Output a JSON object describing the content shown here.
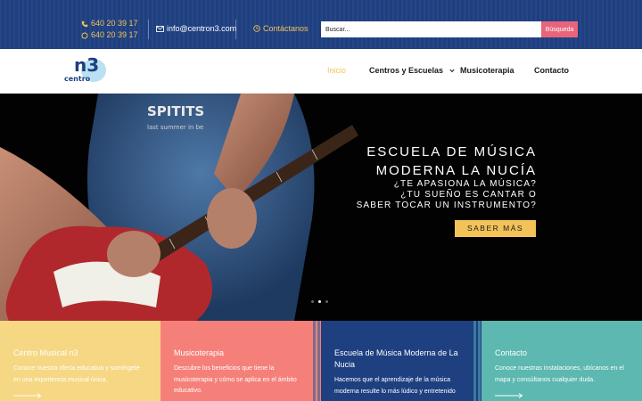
{
  "topbar": {
    "phone1": "640 20 39 17",
    "phone2": "640 20 39 17",
    "email": "info@centron3.com",
    "contact_label": "Contáctanos",
    "search_placeholder": "Buscar...",
    "search_button": "Búsqueda"
  },
  "logo": {
    "text_small": "centro",
    "text_big": "n3"
  },
  "nav": {
    "inicio": "Inicio",
    "centros": "Centros y Escuelas",
    "musicoterapia": "Musicoterapia",
    "contacto": "Contacto"
  },
  "hero": {
    "title_line1": "ESCUELA DE MÚSICA",
    "title_line2": "MODERNA LA NUCÍA",
    "sub_line1": "¿TE APASIONA LA MÚSICA?",
    "sub_line2": "¿TU SUEÑO ES CANTAR O",
    "sub_line3": "SABER TOCAR UN INSTRUMENTO?",
    "button": "SABER MÁS",
    "shirt_text1": "SPITITS",
    "shirt_text2": "last summer in be",
    "slide_count": 3,
    "active_slide": 2
  },
  "cards": [
    {
      "title": "Centro Musical n3",
      "text1": "Conoce nuestra oferta educativa y sumérgete",
      "text2": "en una experiencia musical única.",
      "color": "#f6d784"
    },
    {
      "title": "Musicoterapia",
      "text1": "Descubre los beneficios que tiene la",
      "text2": "musicoterapia y cómo se aplica en el ámbito",
      "text3": "educativo.",
      "color": "#f5807a"
    },
    {
      "title_line1": "Escuela de Música Moderna de La",
      "title_line2": "Nucia",
      "text1": "Hacemos que el aprendizaje de la música",
      "text2": "moderna resulte lo más lúdico y entretenido",
      "color": "#1e3f80"
    },
    {
      "title": "Contacto",
      "text1": "Conoce nuestras instalaciones, ubícanos en el",
      "text2": "mapa y consúltanos cualquier duda.",
      "color": "#5cb8b0"
    }
  ]
}
